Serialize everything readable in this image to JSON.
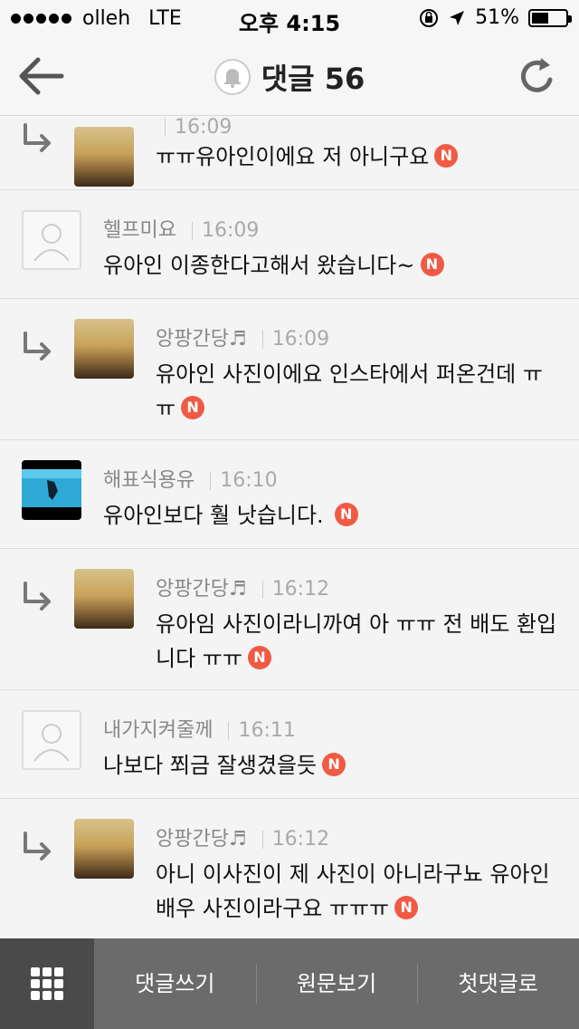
{
  "status_bar": {
    "carrier": "olleh",
    "network": "LTE",
    "time": "오후 4:15",
    "battery": "51%",
    "battery_level": 0.51
  },
  "header": {
    "title": "댓글 56",
    "icons": [
      "back-arrow-icon",
      "bell-icon",
      "refresh-icon"
    ]
  },
  "comments": [
    {
      "type": "reply",
      "avatar": "sunset",
      "author": "",
      "time": "16:09",
      "text": "ㅠㅠ유아인이에요 저 아니구요"
    },
    {
      "type": "comment",
      "avatar": "placeholder",
      "author": "헬프미요",
      "time": "16:09",
      "text": "유아인 이종한다고해서 왔습니다~"
    },
    {
      "type": "reply",
      "avatar": "sunset",
      "author": "앙팡간당♬",
      "time": "16:09",
      "text": "유아인 사진이에요 인스타에서 퍼온건데 ㅠㅠ"
    },
    {
      "type": "comment",
      "avatar": "diver",
      "author": "해표식용유",
      "time": "16:10",
      "text": "유아인보다 훨 낫습니다."
    },
    {
      "type": "reply",
      "avatar": "sunset",
      "author": "앙팡간당♬",
      "time": "16:12",
      "text": "유아임 사진이라니까여 아 ㅠㅠ 전  배도 환입니다 ㅠㅠ"
    },
    {
      "type": "comment",
      "avatar": "placeholder",
      "author": "내가지켜줄께",
      "time": "16:11",
      "text": "나보다 쬐금 잘생겼을듯"
    },
    {
      "type": "reply",
      "avatar": "sunset",
      "author": "앙팡간당♬",
      "time": "16:12",
      "text": "아니 이사진이 제 사진이 아니라구뇨 유아인 배우 사진이라구요 ㅠㅠㅠ"
    }
  ],
  "new_badge": "N",
  "toolbar": {
    "write": "댓글쓰기",
    "original": "원문보기",
    "first": "첫댓글로"
  },
  "colors": {
    "badge": "#f05a45",
    "toolbar": "#6b6b6b",
    "toolbar_dark": "#4a4a4a"
  }
}
